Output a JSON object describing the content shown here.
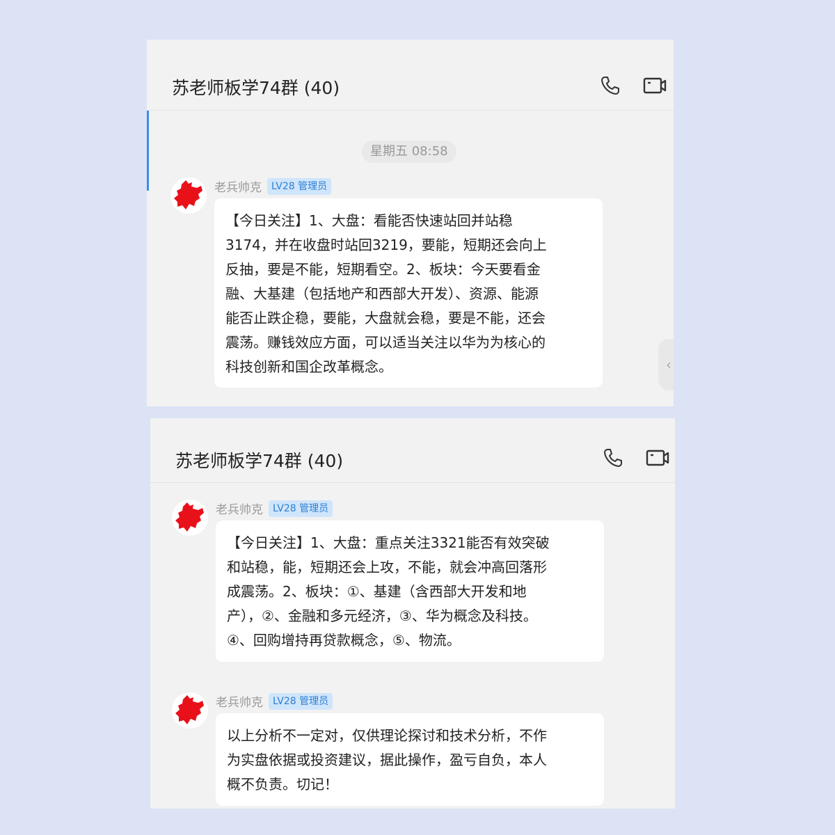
{
  "panels": [
    {
      "header": {
        "title": "苏老师板学74群 (40)",
        "phone_icon": "phone-icon",
        "video_icon": "video-call-icon"
      },
      "time_divider": "星期五 08:58",
      "messages": [
        {
          "sender": "老兵帅克",
          "badge": "LV28 管理员",
          "text": "【今日关注】1、大盘：看能否快速站回并站稳\n3174，并在收盘时站回3219，要能，短期还会向上\n反抽，要是不能，短期看空。2、板块：今天要看金\n融、大基建（包括地产和西部大开发）、资源、能源\n能否止跌企稳，要能，大盘就会稳，要是不能，还会\n震荡。赚钱效应方面，可以适当关注以华为为核心的\n科技创新和国企改革概念。"
        }
      ]
    },
    {
      "header": {
        "title": "苏老师板学74群 (40)",
        "phone_icon": "phone-icon",
        "video_icon": "video-call-icon"
      },
      "messages": [
        {
          "sender": "老兵帅克",
          "badge": "LV28 管理员",
          "text": "【今日关注】1、大盘：重点关注3321能否有效突破\n和站稳，能，短期还会上攻，不能，就会冲高回落形\n成震荡。2、板块：①、基建（含西部大开发和地\n产），②、金融和多元经济，③、华为概念及科技。\n④、回购增持再贷款概念，⑤、物流。"
        },
        {
          "sender": "老兵帅克",
          "badge": "LV28 管理员",
          "text": "以上分析不一定对，仅供理论探讨和技术分析，不作\n为实盘依据或投资建议，据此操作，盈亏自负，本人\n概不负责。切记！"
        }
      ]
    }
  ],
  "colors": {
    "background": "#dbe3f5",
    "panel": "#f2f2f2",
    "badge_bg": "#cfe5fb",
    "badge_text": "#2f7fd0",
    "avatar_red": "#e8111a"
  }
}
